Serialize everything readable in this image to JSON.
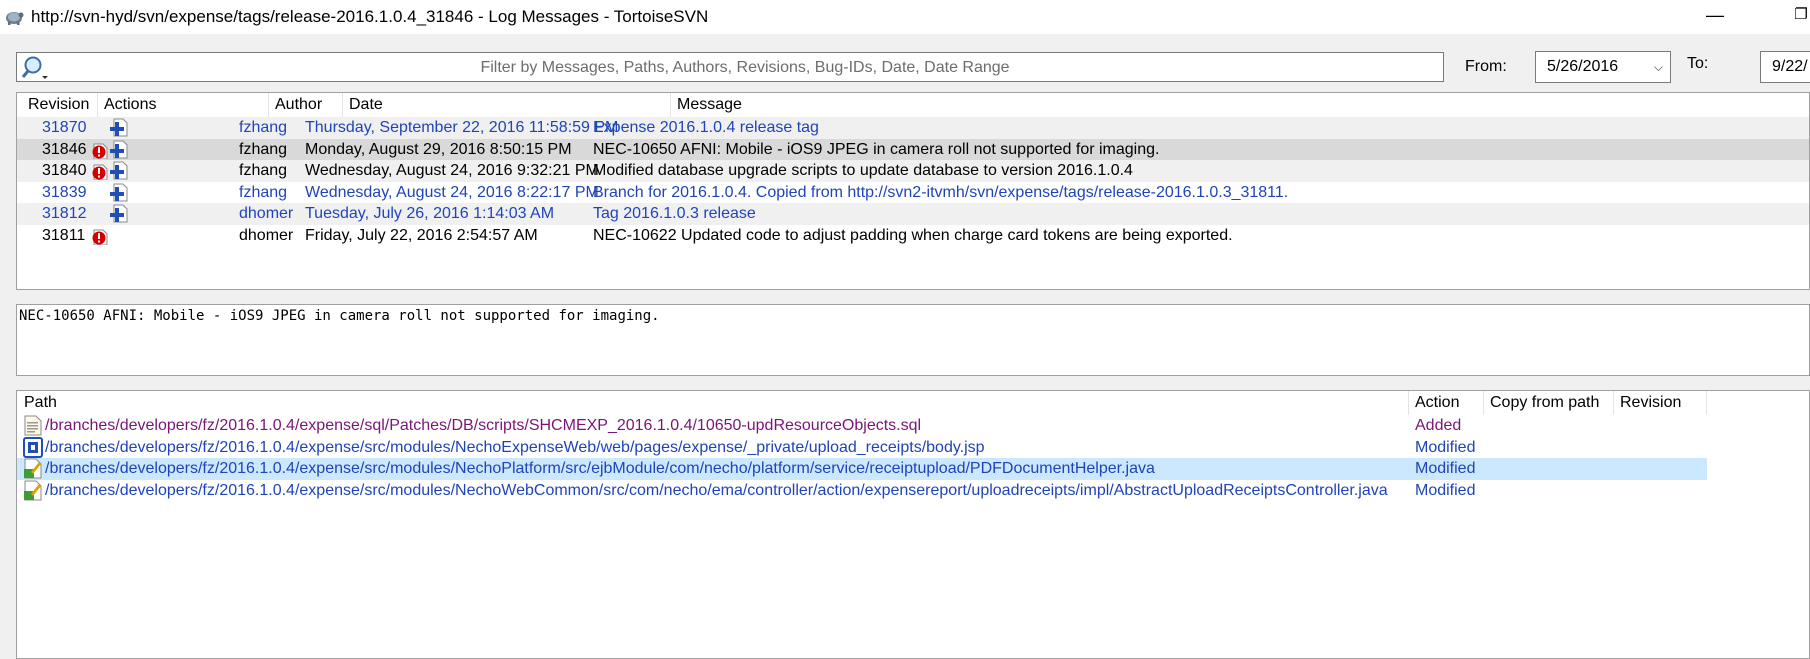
{
  "window": {
    "title": "http://svn-hyd/svn/expense/tags/release-2016.1.0.4_31846 - Log Messages - TortoiseSVN",
    "minimize_glyph": "—",
    "maximize_glyph": "❐"
  },
  "filter": {
    "placeholder": "Filter by Messages, Paths, Authors, Revisions, Bug-IDs, Date, Date Range",
    "from_label": "From:",
    "from_value": "5/26/2016",
    "to_label": "To:",
    "to_value": "9/22/"
  },
  "log_table": {
    "columns": [
      "Revision",
      "Actions",
      "Author",
      "Date",
      "Message"
    ],
    "rows": [
      {
        "revision": "31870",
        "author": "fzhang",
        "date": "Thursday, September 22, 2016 11:58:59 PM",
        "message": "Expense 2016.1.0.4 release tag",
        "icons": [
          "add-icon"
        ],
        "style": "blue"
      },
      {
        "revision": "31846",
        "author": "fzhang",
        "date": "Monday, August 29, 2016 8:50:15 PM",
        "message": "NEC-10650 AFNI: Mobile - iOS9 JPEG in camera roll not supported for imaging.",
        "icons": [
          "error-icon",
          "add-icon"
        ],
        "style": "selected"
      },
      {
        "revision": "31840",
        "author": "fzhang",
        "date": "Wednesday, August 24, 2016 9:32:21 PM",
        "message": "Modified database upgrade scripts to update database to version 2016.1.0.4",
        "icons": [
          "error-icon",
          "add-icon"
        ],
        "style": "normal"
      },
      {
        "revision": "31839",
        "author": "fzhang",
        "date": "Wednesday, August 24, 2016 8:22:17 PM",
        "message": "Branch for 2016.1.0.4. Copied from http://svn2-itvmh/svn/expense/tags/release-2016.1.0.3_31811.",
        "icons": [
          "add-icon"
        ],
        "style": "blue"
      },
      {
        "revision": "31812",
        "author": "dhomer",
        "date": "Tuesday, July 26, 2016 1:14:03 AM",
        "message": "Tag 2016.1.0.3 release",
        "icons": [
          "add-icon"
        ],
        "style": "blue"
      },
      {
        "revision": "31811",
        "author": "dhomer",
        "date": "Friday, July 22, 2016 2:54:57 AM",
        "message": "NEC-10622 Updated code to adjust padding when charge card tokens are being exported.",
        "icons": [
          "error-icon"
        ],
        "style": "normal"
      }
    ],
    "scroll_left_glyph": "<"
  },
  "message_box": {
    "text": "NEC-10650 AFNI: Mobile - iOS9 JPEG in camera roll not supported for imaging."
  },
  "paths_table": {
    "columns": [
      "Path",
      "Action",
      "Copy from path",
      "Revision"
    ],
    "rows": [
      {
        "path": "/branches/developers/fz/2016.1.0.4/expense/sql/Patches/DB/scripts/SHCMEXP_2016.1.0.4/10650-updResourceObjects.sql",
        "action": "Added",
        "icon": "sql-file-icon",
        "color": "#7a1577",
        "selected": false
      },
      {
        "path": "/branches/developers/fz/2016.1.0.4/expense/src/modules/NechoExpenseWeb/web/pages/expense/_private/upload_receipts/body.jsp",
        "action": "Modified",
        "icon": "jsp-file-icon",
        "color": "#1f44b9",
        "selected": false
      },
      {
        "path": "/branches/developers/fz/2016.1.0.4/expense/src/modules/NechoPlatform/src/ejbModule/com/necho/platform/service/receiptupload/PDFDocumentHelper.java",
        "action": "Modified",
        "icon": "java-file-icon",
        "color": "#1f44b9",
        "selected": true
      },
      {
        "path": "/branches/developers/fz/2016.1.0.4/expense/src/modules/NechoWebCommon/src/com/necho/ema/controller/action/expensereport/uploadreceipts/impl/AbstractUploadReceiptsController.java",
        "action": "Modified",
        "icon": "java-file-icon",
        "color": "#1f44b9",
        "selected": false
      }
    ]
  },
  "colors": {
    "blue_text": "#1f44b9",
    "added_text": "#7a1577",
    "selection_blue": "#cce8ff",
    "selection_gray": "#d9d9d9",
    "error_red": "#d40000",
    "add_blue": "#1f4fb5"
  }
}
